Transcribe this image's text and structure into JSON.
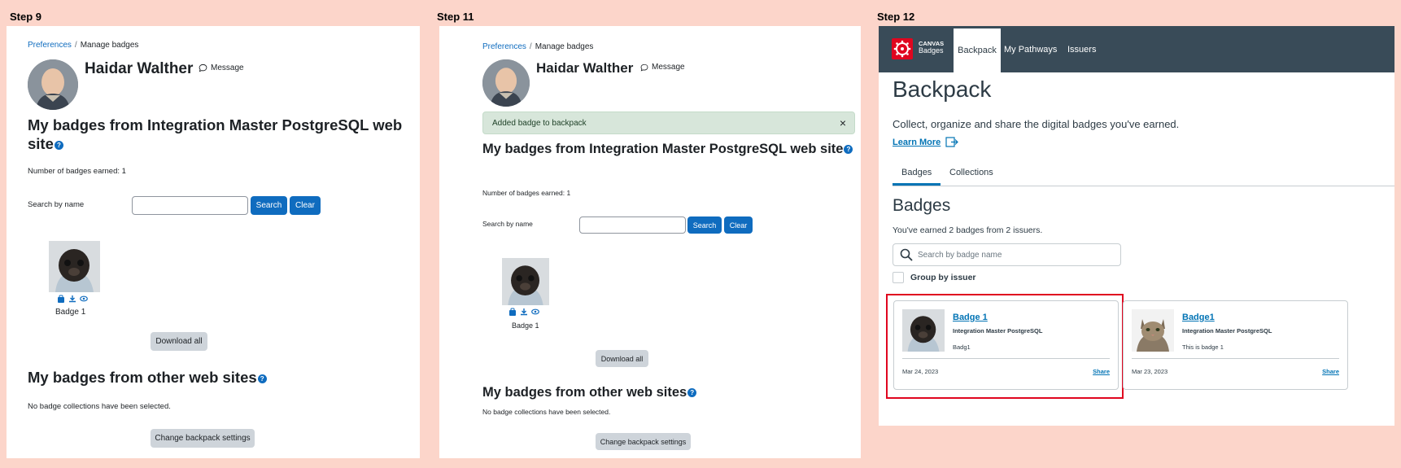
{
  "steps": [
    "Step 9",
    "Step 11",
    "Step 12"
  ],
  "moodle": {
    "breadcrumb": {
      "root": "Preferences",
      "sep": "/",
      "current": "Manage badges"
    },
    "user_name": "Haidar Walther",
    "message_label": "Message",
    "alert_text": "Added badge to backpack",
    "alert_close": "×",
    "heading_site": "My badges from Integration Master PostgreSQL web site",
    "help_icon": "?",
    "badges_earned": "Number of badges earned: 1",
    "search_label": "Search by name",
    "search_button": "Search",
    "clear_button": "Clear",
    "badge_name": "Badge 1",
    "download_all": "Download all",
    "heading_other": "My badges from other web sites",
    "no_collections": "No badge collections have been selected.",
    "change_backpack": "Change backpack settings"
  },
  "canvas": {
    "brand_line1": "CANVAS",
    "brand_line2": "Badges",
    "nav": [
      "Backpack",
      "My Pathways",
      "Issuers"
    ],
    "title": "Backpack",
    "subtitle": "Collect, organize and share the digital badges you've earned.",
    "learn_more": "Learn More",
    "tabs": [
      "Badges",
      "Collections"
    ],
    "section_title": "Badges",
    "earned_text": "You've earned 2 badges from 2 issuers.",
    "search_placeholder": "Search by badge name",
    "group_label": "Group by issuer",
    "cards": [
      {
        "title": "Badge 1",
        "issuer": "Integration Master PostgreSQL",
        "desc": "Badg1",
        "date": "Mar 24, 2023",
        "share": "Share"
      },
      {
        "title": "Badge1",
        "issuer": "Integration Master PostgreSQL",
        "desc": "This is badge 1",
        "date": "Mar 23, 2023",
        "share": "Share"
      }
    ]
  },
  "colors": {
    "accent": "#0f6cbf",
    "canvas_red": "#e0061f",
    "canvas_nav": "#394b58",
    "highlight": "#e0061f"
  }
}
